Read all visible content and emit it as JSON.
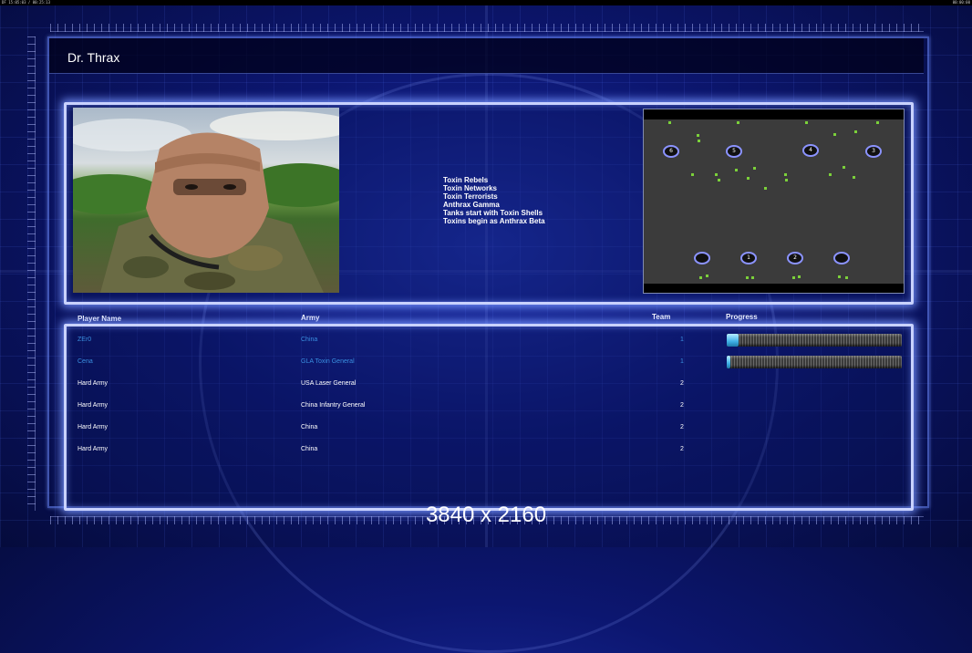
{
  "topbar": {
    "left_text": "DF 15:05:03 / 00:25:13",
    "right_text": "00:00:00"
  },
  "header": {
    "title": "Dr. Thrax"
  },
  "general": {
    "portrait_icon": "general-portrait-icon",
    "features": [
      "Toxin Rebels",
      "Toxin Networks",
      "Toxin Terrorists",
      "Anthrax Gamma",
      "Tanks start with Toxin Shells",
      "Toxins begin as Anthrax Beta"
    ]
  },
  "minimap": {
    "spawns_top": [
      "6",
      "5",
      "4",
      "3"
    ],
    "spawns_bottom": [
      "",
      "1",
      "2",
      ""
    ]
  },
  "table": {
    "headers": {
      "name": "Player Name",
      "army": "Army",
      "team": "Team",
      "progress": "Progress"
    },
    "rows": [
      {
        "name": "ZEr0",
        "army": "China",
        "team": "1",
        "progress": 0.07,
        "highlight": true
      },
      {
        "name": "Cena",
        "army": "GLA Toxin General",
        "team": "1",
        "progress": 0.02,
        "highlight": true
      },
      {
        "name": "Hard Army",
        "army": "USA Laser General",
        "team": "2",
        "progress": null,
        "highlight": false
      },
      {
        "name": "Hard Army",
        "army": "China Infantry General",
        "team": "2",
        "progress": null,
        "highlight": false
      },
      {
        "name": "Hard Army",
        "army": "China",
        "team": "2",
        "progress": null,
        "highlight": false
      },
      {
        "name": "Hard Army",
        "army": "China",
        "team": "2",
        "progress": null,
        "highlight": false
      }
    ]
  },
  "colors": {
    "highlight_text": "#3a8fe0",
    "normal_text": "#ffffff",
    "frame_glow": "#c9d2ff"
  },
  "resolution_caption": "3840 x 2160"
}
